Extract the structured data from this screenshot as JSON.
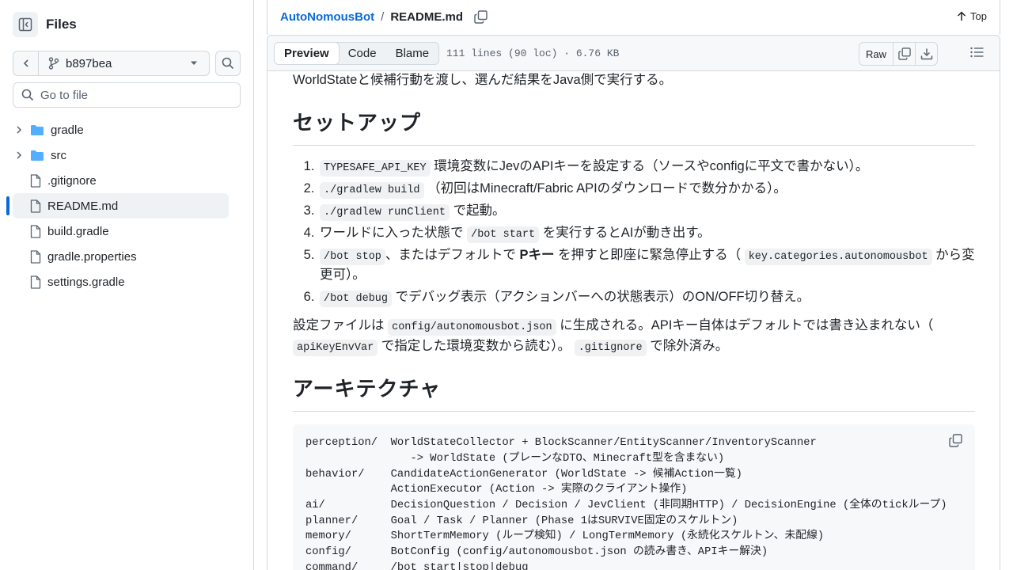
{
  "sidebar": {
    "title": "Files",
    "branch": "b897bea",
    "goto_placeholder": "Go to file",
    "items": [
      {
        "label": "gradle",
        "type": "folder"
      },
      {
        "label": "src",
        "type": "folder"
      },
      {
        "label": ".gitignore",
        "type": "file"
      },
      {
        "label": "README.md",
        "type": "file",
        "active": true
      },
      {
        "label": "build.gradle",
        "type": "file"
      },
      {
        "label": "gradle.properties",
        "type": "file"
      },
      {
        "label": "settings.gradle",
        "type": "file"
      }
    ]
  },
  "header": {
    "repo": "AutoNomousBot",
    "separator": "/",
    "file": "README.md",
    "top_label": "Top"
  },
  "file_header": {
    "tabs": [
      "Preview",
      "Code",
      "Blame"
    ],
    "meta": "111 lines (90 loc) · 6.76 KB",
    "raw_label": "Raw"
  },
  "readme": {
    "intro": "WorldStateと候補行動を渡し、選んだ結果をJava側で実行する。",
    "setup_title": "セットアップ",
    "steps": [
      {
        "code": "TYPESAFE_API_KEY",
        "text": " 環境変数にJevのAPIキーを設定する（ソースやconfigに平文で書かない）。"
      },
      {
        "code": "./gradlew build",
        "text": " （初回はMinecraft/Fabric APIのダウンロードで数分かかる）。"
      },
      {
        "code": "./gradlew runClient",
        "text": " で起動。"
      },
      {
        "pre": "ワールドに入った状態で ",
        "code": "/bot start",
        "text": " を実行するとAIが動き出す。"
      },
      {
        "code": "/bot stop",
        "mid": "、またはデフォルトで ",
        "bold": "Pキー",
        "mid2": " を押すと即座に緊急停止する（ ",
        "code2": "key.categories.autonomousbot",
        "text": " から変更可）。"
      },
      {
        "code": "/bot debug",
        "text": " でデバッグ表示（アクションバーへの状態表示）のON/OFF切り替え。"
      }
    ],
    "config_para": {
      "a": "設定ファイルは ",
      "code1": "config/autonomousbot.json",
      "b": " に生成される。APIキー自体はデフォルトでは書き込まれない（ ",
      "code2": "apiKeyEnvVar",
      "c": " で指定した環境変数から読む）。 ",
      "code3": ".gitignore",
      "d": " で除外済み。"
    },
    "arch_title": "アーキテクチャ",
    "code_block": "perception/  WorldStateCollector + BlockScanner/EntityScanner/InventoryScanner\n                -> WorldState (プレーンなDTO、Minecraft型を含まない)\nbehavior/    CandidateActionGenerator (WorldState -> 候補Action一覧)\n             ActionExecutor (Action -> 実際のクライアント操作)\nai/          DecisionQuestion / Decision / JevClient (非同期HTTP) / DecisionEngine (全体のtickループ)\nplanner/     Goal / Task / Planner (Phase 1はSURVIVE固定のスケルトン)\nmemory/      ShortTermMemory (ループ検知) / LongTermMemory (永続化スケルトン、未配線)\nconfig/      BotConfig (config/autonomousbot.json の読み書き、APIキー解決)\ncommand/     /bot start|stop|debug"
  },
  "colors": {
    "accent": "#0969da",
    "folder": "#54aeff",
    "border": "#d1d9e0"
  }
}
